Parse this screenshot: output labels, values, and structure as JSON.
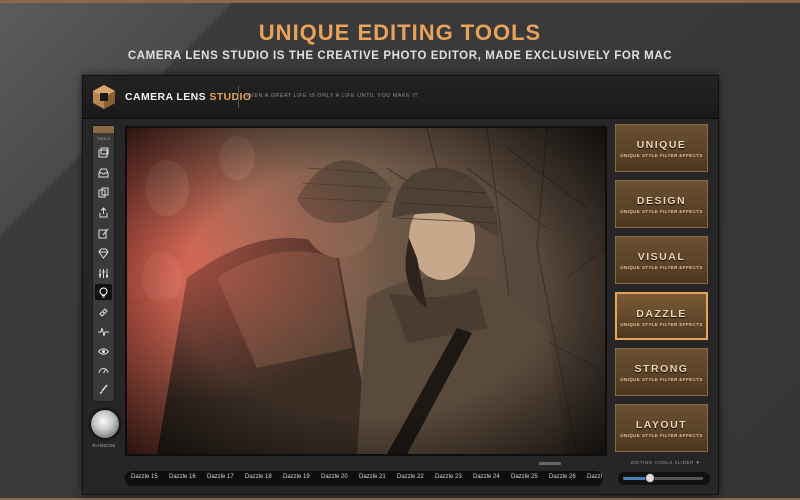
{
  "hero": {
    "headline": "UNIQUE EDITING TOOLS",
    "subheadline": "CAMERA LENS STUDIO IS THE CREATIVE PHOTO EDITOR, MADE EXCLUSIVELY FOR MAC"
  },
  "app": {
    "name_part1": "CAMERA LENS",
    "name_part2": "STUDIO",
    "tagline": "EVEN A GREAT LIFE IS ONLY A LIFE UNTIL YOU MAKE IT"
  },
  "toolbar": {
    "label": "TOOLS",
    "tools": [
      {
        "icon": "images-icon"
      },
      {
        "icon": "tray-icon"
      },
      {
        "icon": "copy-icon"
      },
      {
        "icon": "export-icon"
      },
      {
        "icon": "edit-icon"
      },
      {
        "icon": "diamond-icon"
      },
      {
        "icon": "sliders-icon"
      },
      {
        "icon": "lightbulb-icon",
        "active": true
      },
      {
        "icon": "bandage-icon"
      },
      {
        "icon": "pulse-icon"
      },
      {
        "icon": "eye-icon"
      },
      {
        "icon": "gauge-icon"
      },
      {
        "icon": "brush-icon"
      }
    ]
  },
  "knob": {
    "label": "RANDOM"
  },
  "presets": [
    {
      "title": "UNIQUE",
      "subtitle": "UNIQUE STYLE FILTER EFFECTS"
    },
    {
      "title": "DESIGN",
      "subtitle": "UNIQUE STYLE FILTER EFFECTS"
    },
    {
      "title": "VISUAL",
      "subtitle": "UNIQUE STYLE FILTER EFFECTS"
    },
    {
      "title": "DAZZLE",
      "subtitle": "UNIQUE STYLE FILTER EFFECTS",
      "selected": true
    },
    {
      "title": "STRONG",
      "subtitle": "UNIQUE STYLE FILTER EFFECTS"
    },
    {
      "title": "LAYOUT",
      "subtitle": "UNIQUE STYLE FILTER EFFECTS"
    }
  ],
  "editing_slider": {
    "label": "EDITING COOLS SLIDER ▼",
    "value_fraction": 0.33
  },
  "filmstrip": [
    "Dazzle 15",
    "Dazzle 16",
    "Dazzle 17",
    "Dazzle 18",
    "Dazzle 19",
    "Dazzle 20",
    "Dazzle 21",
    "Dazzle 22",
    "Dazzle 23",
    "Dazzle 24",
    "Dazzle 25",
    "Dazzle 26",
    "Dazzl"
  ],
  "colors": {
    "accent": "#e8a25a",
    "preset_bg": "#5a4128",
    "slider_fill": "#4a7fb8"
  }
}
